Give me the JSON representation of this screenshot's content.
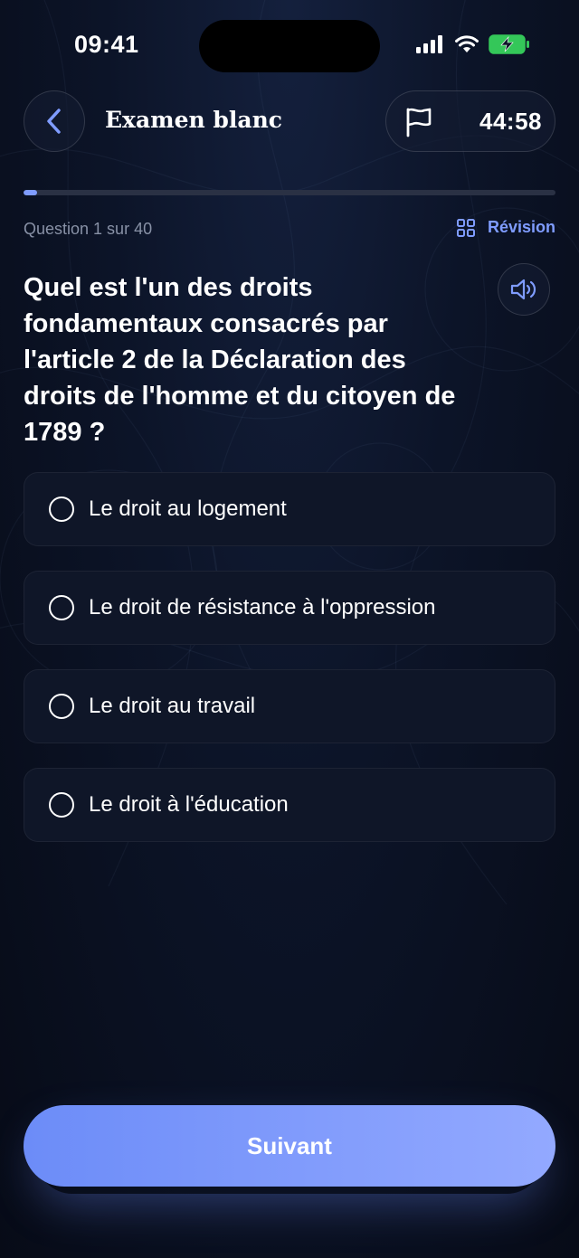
{
  "status_bar": {
    "time": "09:41",
    "icons": [
      "cellular-signal-icon",
      "wifi-icon",
      "battery-charging-icon"
    ],
    "battery_color": "#34c759"
  },
  "header": {
    "back_icon": "chevron-left-icon",
    "title": "Examen blanc",
    "flag_icon": "flag-icon",
    "timer": "44:58"
  },
  "progress": {
    "current": 1,
    "total": 40,
    "fraction": 0.025,
    "label": "Question 1 sur 40"
  },
  "revision": {
    "icon": "grid-icon",
    "label": "Révision"
  },
  "question": {
    "text": "Quel est l'un des droits fondamentaux consacrés par l'article 2 de la Déclaration des droits de l'homme et du citoyen de 1789 ?",
    "audio_icon": "speaker-icon"
  },
  "options": [
    {
      "label": "Le droit au logement",
      "selected": false
    },
    {
      "label": "Le droit de résistance à l'oppression",
      "selected": false
    },
    {
      "label": "Le droit au travail",
      "selected": false
    },
    {
      "label": "Le droit à l'éducation",
      "selected": false
    }
  ],
  "next_button": {
    "label": "Suivant"
  },
  "colors": {
    "accent": "#7f9cff",
    "background": "#070b17",
    "card": "#0f1628",
    "muted_text": "#8891a6"
  }
}
